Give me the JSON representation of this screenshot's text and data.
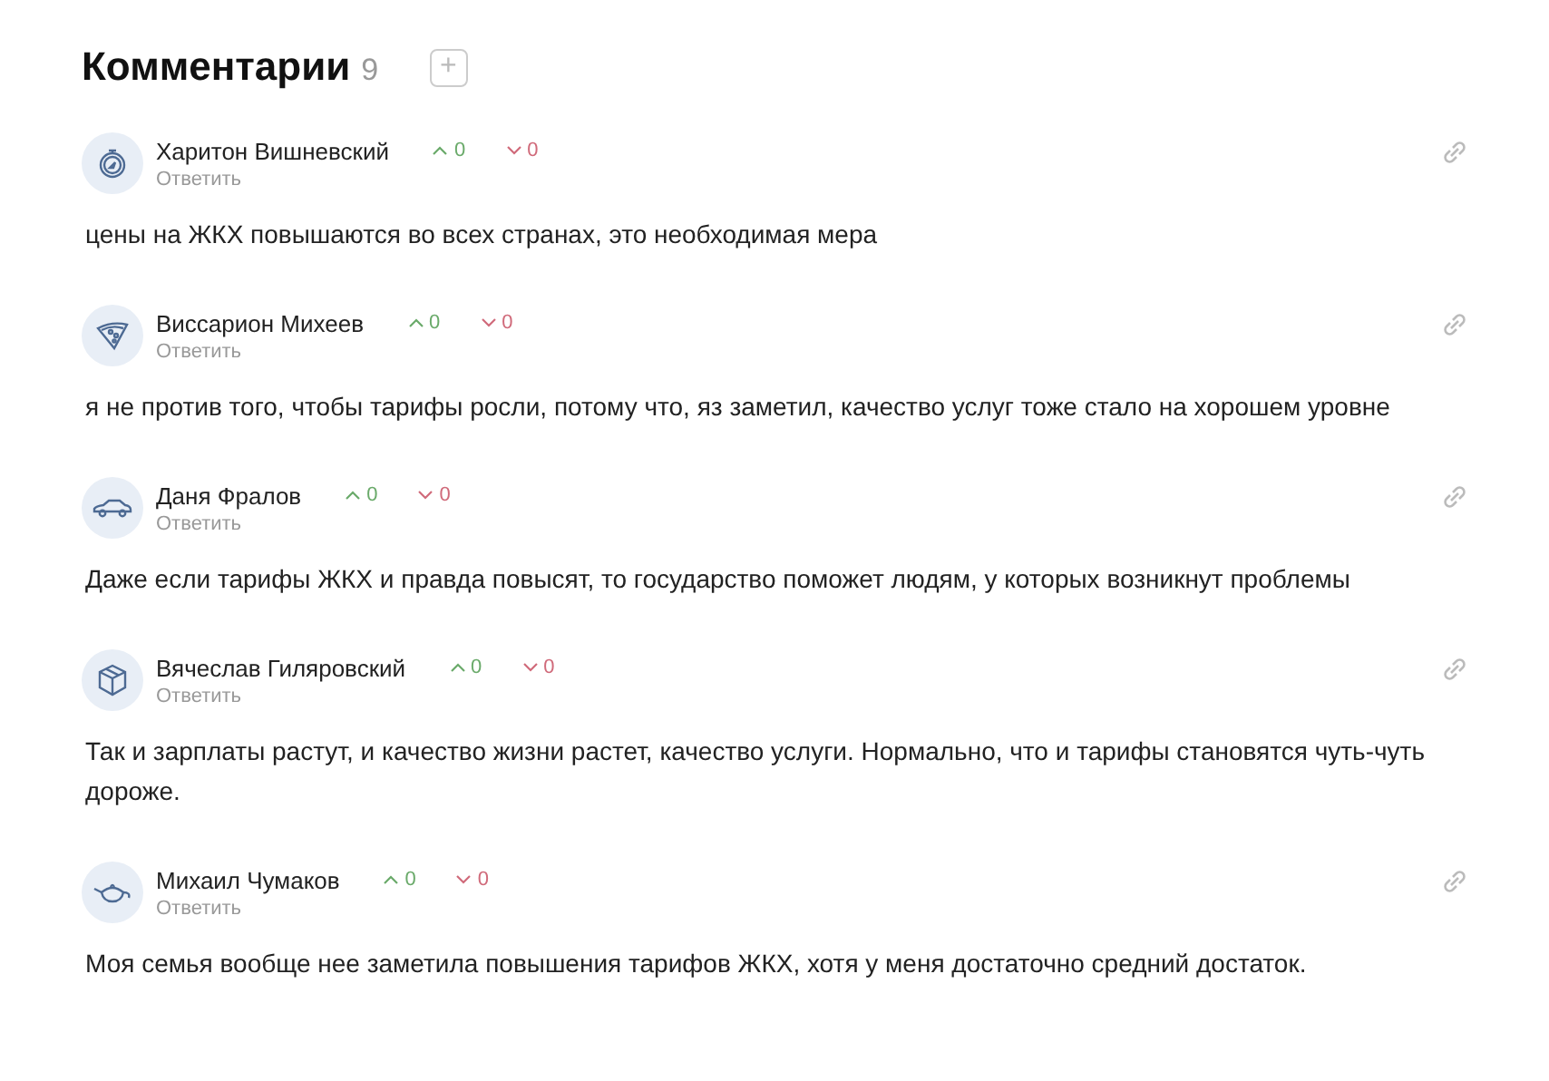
{
  "header": {
    "title": "Комментарии",
    "count": "9",
    "add_button": "+"
  },
  "comments": [
    {
      "kind": "compass",
      "author": "Харитон Вишневский",
      "upvotes": "0",
      "downvotes": "0",
      "reply": "Ответить",
      "text": "цены на ЖКХ повышаются во всех странах, это необходимая мера"
    },
    {
      "kind": "pizza",
      "author": "Виссарион Михеев",
      "upvotes": "0",
      "downvotes": "0",
      "reply": "Ответить",
      "text": "я не против того, чтобы тарифы росли, потому что, яз заметил, качество услуг тоже стало на хорошем уровне"
    },
    {
      "kind": "car",
      "author": "Даня Фралов",
      "upvotes": "0",
      "downvotes": "0",
      "reply": "Ответить",
      "text": "Даже если тарифы ЖКХ и правда повысят, то государство поможет людям, у которых возникнут проблемы"
    },
    {
      "kind": "box",
      "author": "Вячеслав Гиляровский",
      "upvotes": "0",
      "downvotes": "0",
      "reply": "Ответить",
      "text": "Так и зарплаты растут, и качество жизни растет, качество услуги. Нормально, что и тарифы становятся чуть-чуть дороже."
    },
    {
      "kind": "teapot",
      "author": "Михаил Чумаков",
      "upvotes": "0",
      "downvotes": "0",
      "reply": "Ответить",
      "text": "Моя семья вообще нее заметила повышения тарифов ЖКХ, хотя у меня достаточно средний достаток."
    }
  ]
}
